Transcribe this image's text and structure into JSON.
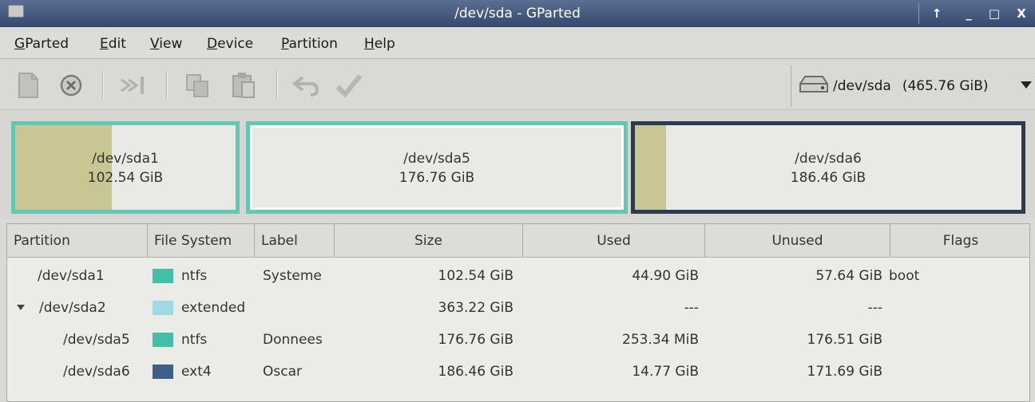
{
  "window": {
    "title": "/dev/sda - GParted",
    "buttons": {
      "up": "↑",
      "minimize": "_",
      "maximize": "□",
      "close": "X"
    }
  },
  "menu": [
    "GParted",
    "Edit",
    "View",
    "Device",
    "Partition",
    "Help"
  ],
  "toolbar": {
    "icons": [
      "new-icon",
      "delete-icon",
      "resize-move-icon",
      "copy-icon",
      "paste-icon",
      "undo-icon",
      "apply-icon"
    ],
    "device": "/dev/sda",
    "device_size": "(465.76 GiB)"
  },
  "partition_map": [
    {
      "name": "/dev/sda1",
      "size": "102.54 GiB",
      "used_fraction": 0.44
    },
    {
      "name": "/dev/sda5",
      "size": "176.76 GiB",
      "used_fraction": 0.0
    },
    {
      "name": "/dev/sda6",
      "size": "186.46 GiB",
      "used_fraction": 0.08
    }
  ],
  "table": {
    "columns": [
      "Partition",
      "File System",
      "Label",
      "Size",
      "Used",
      "Unused",
      "Flags"
    ],
    "rows": [
      {
        "partition": "/dev/sda1",
        "fs": "ntfs",
        "fs_color": "#42bfa6",
        "label": "Systeme",
        "size": "102.54 GiB",
        "used": "44.90 GiB",
        "unused": "57.64 GiB",
        "flags": "boot"
      },
      {
        "partition": "/dev/sda2",
        "fs": "extended",
        "fs_color": "#9fd9e3",
        "label": "",
        "size": "363.22 GiB",
        "used": "---",
        "unused": "---",
        "flags": ""
      },
      {
        "partition": "/dev/sda5",
        "fs": "ntfs",
        "fs_color": "#42bfa6",
        "label": "Donnees",
        "size": "176.76 GiB",
        "used": "253.34 MiB",
        "unused": "176.51 GiB",
        "flags": ""
      },
      {
        "partition": "/dev/sda6",
        "fs": "ext4",
        "fs_color": "#3f5f86",
        "label": "Oscar",
        "size": "186.46 GiB",
        "used": "14.77 GiB",
        "unused": "171.69 GiB",
        "flags": ""
      }
    ]
  }
}
